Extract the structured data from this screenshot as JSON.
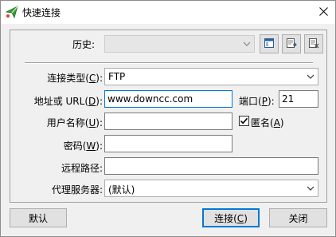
{
  "window": {
    "title": "快速连接",
    "app_icon": "paper-plane-icon",
    "close_icon": "close-icon"
  },
  "history": {
    "label_text": "历史",
    "label_suffix": ":",
    "value": "",
    "toolbar_icons": [
      "panel-icon",
      "import-icon",
      "delete-list-icon"
    ]
  },
  "connection_type": {
    "label": "连接类型(",
    "mnemonic": "C",
    "suffix": "):",
    "value": "FTP"
  },
  "address": {
    "label": "地址或 URL(",
    "mnemonic": "D",
    "suffix": "):",
    "value": "www.downcc.com"
  },
  "port": {
    "label": "端口(",
    "mnemonic": "P",
    "suffix": "):",
    "value": "21"
  },
  "username": {
    "label": "用户名称(",
    "mnemonic": "U",
    "suffix": "):",
    "value": ""
  },
  "anonymous": {
    "label": "匿名(",
    "mnemonic": "A",
    "suffix": ")",
    "checked": true
  },
  "password": {
    "label": "密码(",
    "mnemonic": "W",
    "suffix": "):",
    "value": ""
  },
  "remote_path": {
    "label": "远程路径:",
    "value": ""
  },
  "proxy": {
    "label": "代理服务器:",
    "value": "(默认)"
  },
  "buttons": {
    "default_label": "默认",
    "connect_label": "连接(",
    "connect_mnemonic": "C",
    "connect_suffix": ")",
    "close_label": "关闭"
  }
}
